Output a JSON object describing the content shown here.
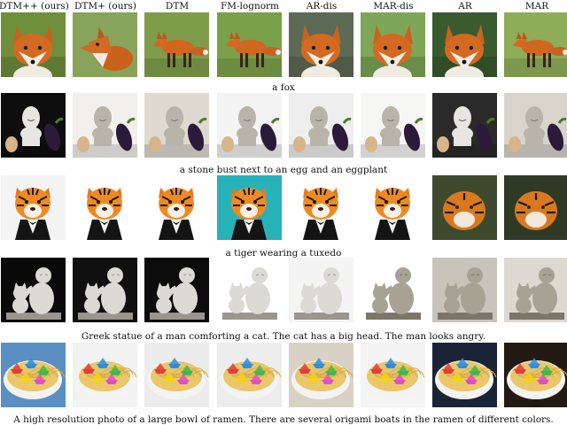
{
  "columns": [
    "DTM++ (ours)",
    "DTM+ (ours)",
    "DTM",
    "FM-lognorm",
    "AR-dis",
    "MAR-dis",
    "AR",
    "MAR"
  ],
  "rows": [
    {
      "caption": "a fox",
      "cells": [
        {
          "subject": "fox-face",
          "bg": "#6f8f3c"
        },
        {
          "subject": "fox-side",
          "bg": "#88a35a"
        },
        {
          "subject": "fox-walk",
          "bg": "#7f9c4a"
        },
        {
          "subject": "fox-walk",
          "bg": "#7aa04a"
        },
        {
          "subject": "fox-face",
          "bg": "#5d6a55"
        },
        {
          "subject": "fox-face",
          "bg": "#7ea658"
        },
        {
          "subject": "fox-face",
          "bg": "#395b2e"
        },
        {
          "subject": "fox-walk",
          "bg": "#8fac58"
        }
      ]
    },
    {
      "caption": "a stone bust next to an egg and an eggplant",
      "cells": [
        {
          "subject": "bust-dark",
          "bg": "#0e0e0e"
        },
        {
          "subject": "bust-light",
          "bg": "#f2f0ec"
        },
        {
          "subject": "bust-light",
          "bg": "#dedad2"
        },
        {
          "subject": "bust-light",
          "bg": "#f4f4f4"
        },
        {
          "subject": "bust-light",
          "bg": "#eeeeee"
        },
        {
          "subject": "bust-light",
          "bg": "#f6f6f4"
        },
        {
          "subject": "bust-dark",
          "bg": "#2a2a2a"
        },
        {
          "subject": "bust-light",
          "bg": "#d8d4cc"
        }
      ]
    },
    {
      "caption": "a tiger wearing a tuxedo",
      "cells": [
        {
          "subject": "tiger",
          "bg": "#f4f4f4"
        },
        {
          "subject": "tiger",
          "bg": "#ffffff"
        },
        {
          "subject": "tiger",
          "bg": "#ffffff"
        },
        {
          "subject": "tiger",
          "bg": "#27b2b8"
        },
        {
          "subject": "tiger",
          "bg": "#ffffff"
        },
        {
          "subject": "tiger",
          "bg": "#ffffff"
        },
        {
          "subject": "tiger-photo",
          "bg": "#3e4a2e"
        },
        {
          "subject": "tiger-photo",
          "bg": "#2e3a26"
        }
      ]
    },
    {
      "caption": "Greek statue of a man comforting a cat. The cat has a big head. The man looks angry.",
      "cells": [
        {
          "subject": "statue-dark",
          "bg": "#0a0a0a"
        },
        {
          "subject": "statue-dark",
          "bg": "#101010"
        },
        {
          "subject": "statue-dark",
          "bg": "#0c0c0c"
        },
        {
          "subject": "statue-dark",
          "bg": "#ffffff"
        },
        {
          "subject": "statue-dark",
          "bg": "#f4f4f4"
        },
        {
          "subject": "statue-light",
          "bg": "#ffffff"
        },
        {
          "subject": "statue-light",
          "bg": "#c8c4bc"
        },
        {
          "subject": "statue-light",
          "bg": "#ddd9d0"
        }
      ]
    },
    {
      "caption": "A high resolution photo of a large bowl of ramen. There are several origami boats in the ramen of different colors.",
      "cells": [
        {
          "subject": "ramen",
          "bg": "#5a8fc4"
        },
        {
          "subject": "ramen",
          "bg": "#f2f2f2"
        },
        {
          "subject": "ramen",
          "bg": "#ececec"
        },
        {
          "subject": "ramen",
          "bg": "#ededed"
        },
        {
          "subject": "ramen",
          "bg": "#d9d2c4"
        },
        {
          "subject": "ramen",
          "bg": "#f4f4f4"
        },
        {
          "subject": "ramen",
          "bg": "#1a2436"
        },
        {
          "subject": "ramen",
          "bg": "#231a14"
        }
      ]
    }
  ]
}
